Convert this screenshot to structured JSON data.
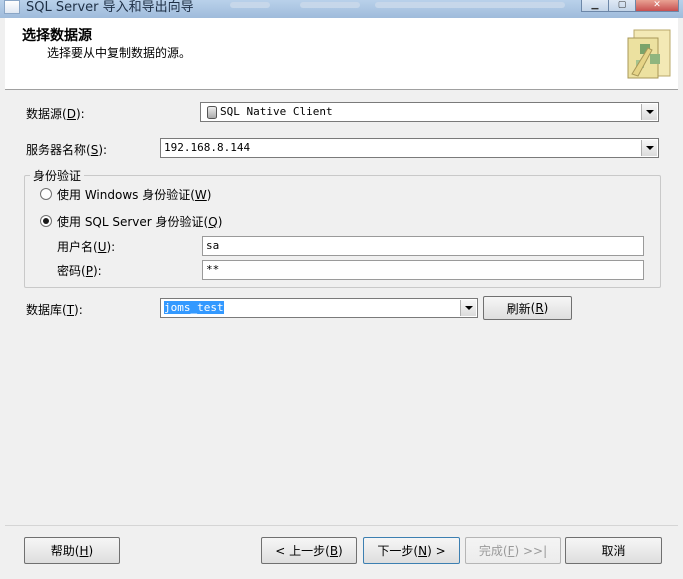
{
  "window": {
    "title": "SQL Server 导入和导出向导"
  },
  "header": {
    "title": "选择数据源",
    "subtitle": "选择要从中复制数据的源。"
  },
  "datasource": {
    "label": "数据源",
    "key": "D",
    "value": "SQL Native Client"
  },
  "server": {
    "label": "服务器名称",
    "key": "S",
    "value": "192.168.8.144"
  },
  "auth": {
    "group_label": "身份验证",
    "windows": {
      "label": "使用 Windows 身份验证",
      "key": "W",
      "checked": false
    },
    "sql": {
      "label": "使用 SQL Server 身份验证",
      "key": "Q",
      "checked": true
    },
    "username": {
      "label": "用户名",
      "key": "U",
      "value": "sa"
    },
    "password": {
      "label": "密码",
      "key": "P",
      "value": "**"
    }
  },
  "database": {
    "label": "数据库",
    "key": "T",
    "value": "joms_test",
    "refresh_label": "刷新",
    "refresh_key": "R"
  },
  "buttons": {
    "help": {
      "label": "帮助",
      "key": "H"
    },
    "back": {
      "label": "< 上一步",
      "key": "B"
    },
    "next": {
      "label": "下一步",
      "key": "N",
      "suffix": ">"
    },
    "finish": {
      "label": "完成",
      "key": "F",
      "suffix": ">>|"
    },
    "cancel": {
      "label": "取消"
    }
  }
}
